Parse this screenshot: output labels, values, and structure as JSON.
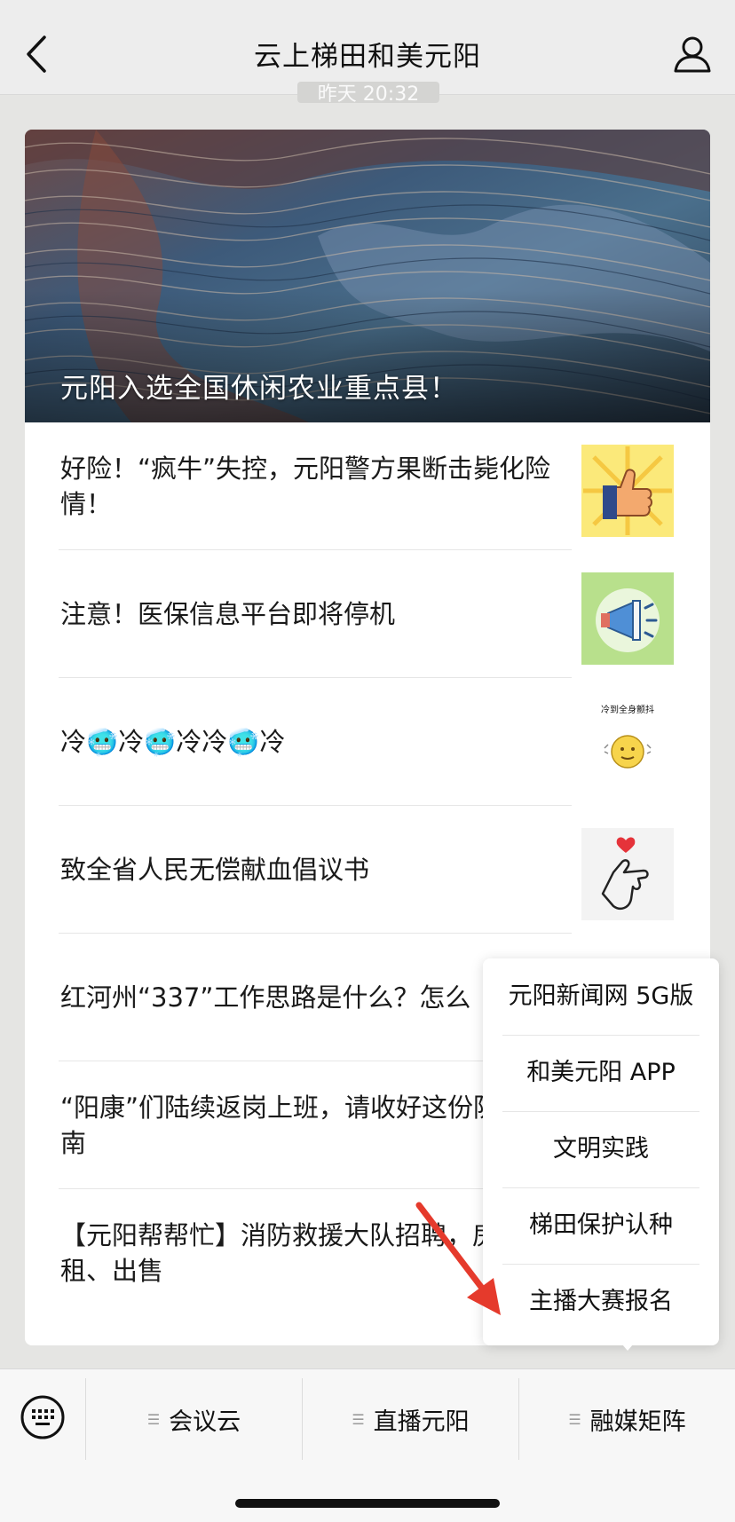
{
  "header": {
    "title": "云上梯田和美元阳",
    "time": "昨天 20:32"
  },
  "cover": {
    "title": "元阳入选全国休闲农业重点县！"
  },
  "articles": [
    {
      "title": "好险！“疯牛”失控，元阳警方果断击毙化险情！",
      "thumb_icon": "thumbs-up-sun-icon"
    },
    {
      "title": "注意！医保信息平台即将停机",
      "thumb_icon": "megaphone-icon"
    },
    {
      "title": "冷🥶冷🥶冷冷🥶冷",
      "thumb_icon": "shivering-face-icon",
      "thumb_caption": "冷到全身颤抖"
    },
    {
      "title": "致全省人民无偿献血倡议书",
      "thumb_icon": "finger-heart-icon"
    },
    {
      "title": "红河州“337”工作思路是什么？怎么"
    },
    {
      "title": "“阳康”们陆续返岗上班，请收好这份防护指南"
    },
    {
      "title": "【元阳帮帮忙】消防救援大队招聘，房屋出租、出售"
    }
  ],
  "popup_menu": {
    "items": [
      "元阳新闻网 5G版",
      "和美元阳 APP",
      "文明实践",
      "梯田保护认种",
      "主播大赛报名"
    ]
  },
  "bottom_menu": {
    "tabs": [
      "会议云",
      "直播元阳",
      "融媒矩阵"
    ]
  },
  "colors": {
    "arrow": "#e53a2c",
    "background": "#e5e5e3"
  }
}
